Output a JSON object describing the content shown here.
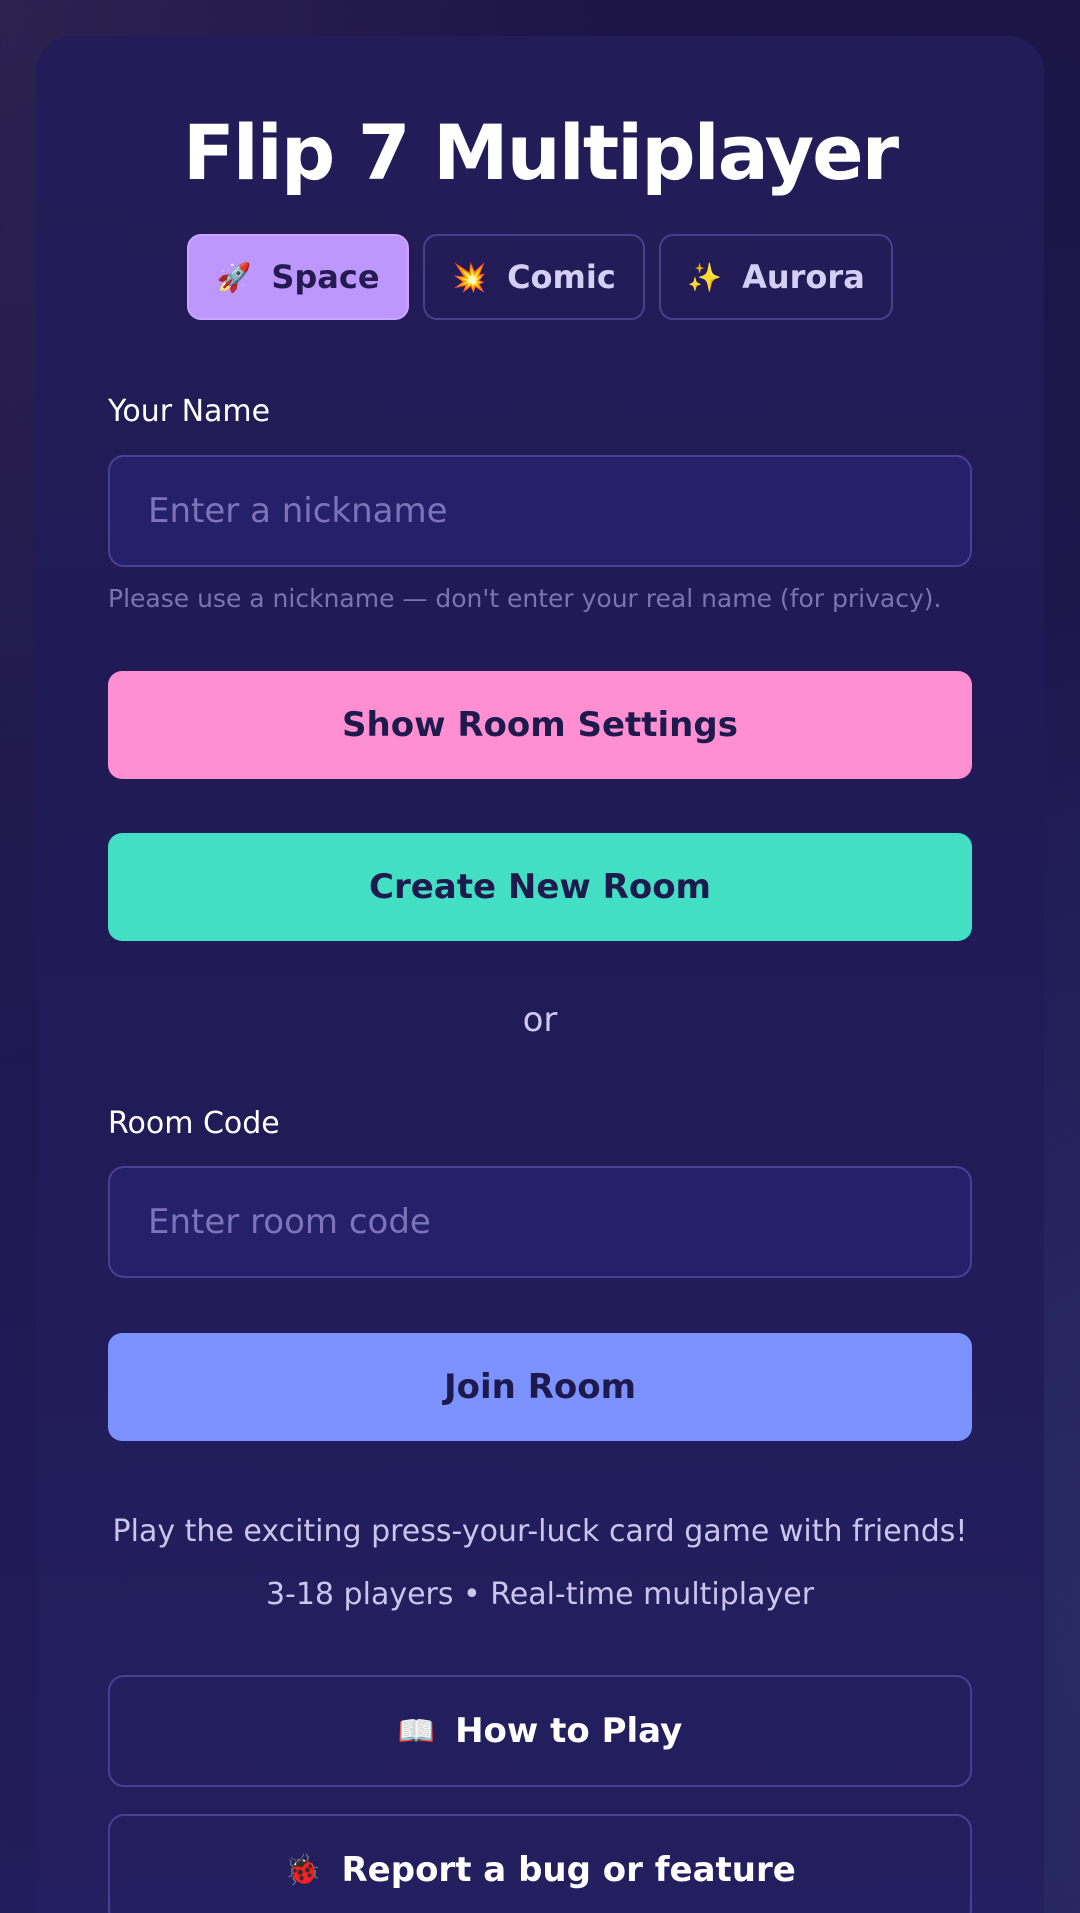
{
  "app": {
    "title": "Flip 7 Multiplayer"
  },
  "themes": [
    {
      "label": "Space",
      "icon": "🚀",
      "icon_name": "rocket-icon",
      "active": true
    },
    {
      "label": "Comic",
      "icon": "💥",
      "icon_name": "collision-icon",
      "active": false
    },
    {
      "label": "Aurora",
      "icon": "✨",
      "icon_name": "sparkles-icon",
      "active": false
    }
  ],
  "name_section": {
    "label": "Your Name",
    "placeholder": "Enter a nickname",
    "value": "",
    "hint": "Please use a nickname — don't enter your real name (for privacy)."
  },
  "actions": {
    "room_settings_label": "Show Room Settings",
    "create_room_label": "Create New Room",
    "separator": "or"
  },
  "room_code_section": {
    "label": "Room Code",
    "placeholder": "Enter room code",
    "value": "",
    "join_label": "Join Room"
  },
  "info": {
    "tagline": "Play the exciting press-your-luck card game with friends!",
    "details": "3-18 players • Real-time multiplayer"
  },
  "footer_buttons": {
    "how_to_play": {
      "label": "How to Play",
      "icon": "📖",
      "icon_name": "book-icon"
    },
    "report": {
      "label": "Report a bug or feature",
      "icon": "🐞",
      "icon_name": "ladybug-icon"
    }
  },
  "colors": {
    "background": "#1e1850",
    "accent_space": "#bd97fb",
    "pink_button": "#ff8fd0",
    "teal_button": "#42dfc5",
    "blue_button": "#7b92ff"
  }
}
